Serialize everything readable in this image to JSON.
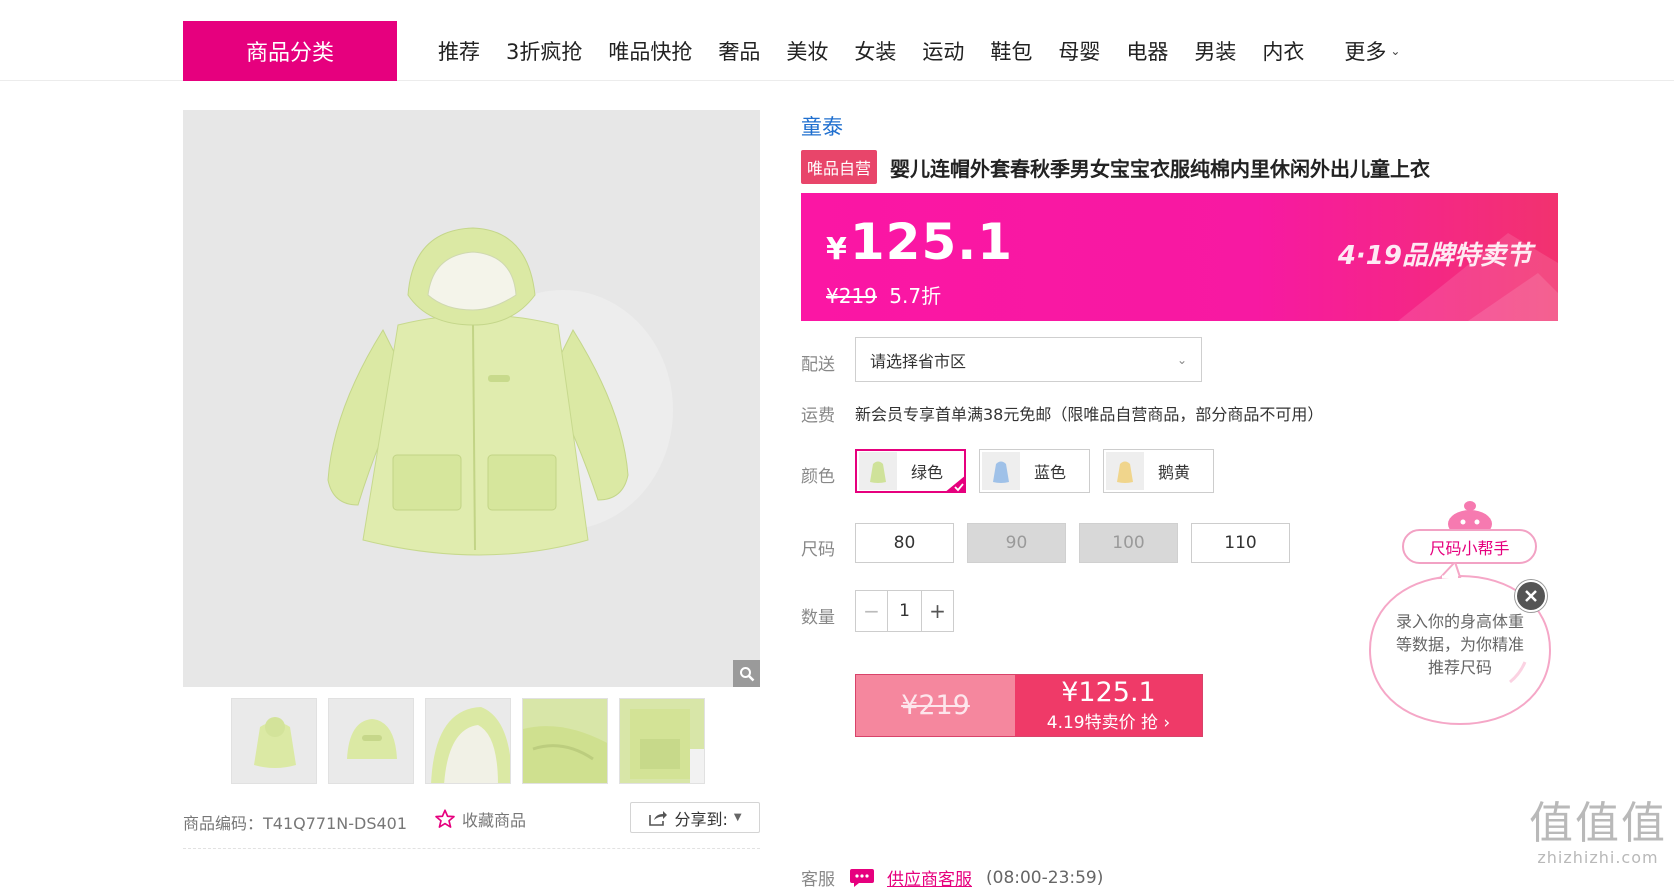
{
  "nav": {
    "category_label": "商品分类",
    "items": [
      "推荐",
      "3折疯抢",
      "唯品快抢",
      "奢品",
      "美妆",
      "女装",
      "运动",
      "鞋包",
      "母婴",
      "电器",
      "男装",
      "内衣"
    ],
    "more_label": "更多"
  },
  "gallery": {
    "thumbnail_count": 5,
    "item_code": "商品编码：T41Q771N-DS401",
    "favorite_label": "收藏商品",
    "share_label": "分享到:"
  },
  "product": {
    "brand": "童泰",
    "badge": "唯品自营",
    "title": "婴儿连帽外套春秋季男女宝宝衣服纯棉内里休闲外出儿童上衣"
  },
  "price": {
    "currency": "¥",
    "current": "125.1",
    "original": "¥219",
    "discount": "5.7折",
    "promo": "4·19品牌特卖节"
  },
  "delivery": {
    "label": "配送",
    "placeholder": "请选择省市区"
  },
  "shipping": {
    "label": "运费",
    "text": "新会员专享首单满38元免邮（限唯品自营商品，部分商品不可用）"
  },
  "color": {
    "label": "颜色",
    "options": [
      "绿色",
      "蓝色",
      "鹅黄"
    ],
    "selected": "绿色"
  },
  "size": {
    "label": "尺码",
    "options": [
      "80",
      "90",
      "100",
      "110"
    ],
    "unavailable": [
      "90",
      "100"
    ]
  },
  "quantity": {
    "label": "数量",
    "value": "1",
    "minus": "−",
    "plus": "+"
  },
  "buy": {
    "original": "¥219",
    "price": "¥125.1",
    "subtitle": "4.19特卖价 抢 ›"
  },
  "service": {
    "label": "客服",
    "link": "供应商客服",
    "hours": "(08:00-23:59)"
  },
  "size_helper": {
    "title": "尺码小帮手",
    "text": "录入你的身高体重等数据，为你精准推荐尺码"
  },
  "watermark": {
    "big": "值值值",
    "small": "zhizhizhi.com"
  },
  "colors": {
    "brand_pink": "#e6007e",
    "banner_start": "#fb16a4",
    "badge": "#e8456a",
    "buy_right": "#ef3a68",
    "buy_left": "#f5879e",
    "brand_link": "#1f6fcf"
  }
}
